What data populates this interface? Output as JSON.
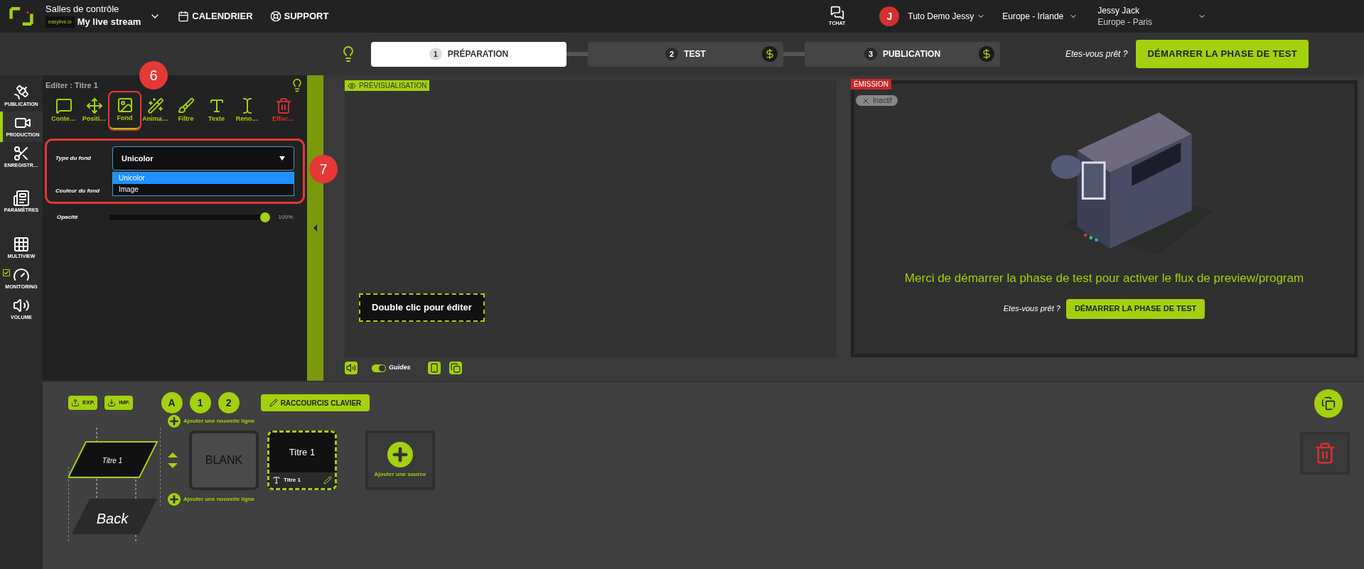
{
  "header": {
    "section": "Salles de contrôle",
    "brand": "easylive.io",
    "stream": "My live stream",
    "nav": [
      "CALENDRIER",
      "SUPPORT"
    ],
    "chat": "TCHAT",
    "avatar": "J",
    "account": "Tuto Demo Jessy",
    "region": "Europe - Irlande",
    "user": "Jessy Jack",
    "user_zone": "Europe - Paris"
  },
  "steps": [
    {
      "number": "1",
      "label": "PRÉPARATION",
      "selected": true,
      "paid": false
    },
    {
      "number": "2",
      "label": "TEST",
      "selected": false,
      "paid": true
    },
    {
      "number": "3",
      "label": "PUBLICATION",
      "selected": false,
      "paid": true
    }
  ],
  "ready_prompt": "Etes-vous prêt ?",
  "start_button": "DÉMARRER LA PHASE DE TEST",
  "sidebar": [
    {
      "label": "PUBLICATION",
      "kind": "plain",
      "selected": false
    },
    {
      "label": "PRODUCTION",
      "kind": "plain",
      "selected": true
    },
    {
      "label": "ENREGISTR…",
      "kind": "plain",
      "selected": false
    },
    {
      "label": "PARAMÈTRES",
      "kind": "plain",
      "selected": false
    },
    {
      "label": "MULTIVIEW",
      "kind": "plain",
      "selected": false
    },
    {
      "label": "MONITORING",
      "kind": "checkbox",
      "checked": true
    },
    {
      "label": "VOLUME",
      "kind": "plain",
      "selected": false
    }
  ],
  "editor": {
    "title": "Editer : Titre 1",
    "tools": [
      {
        "label": "Conte…",
        "selected": false,
        "danger": false
      },
      {
        "label": "Positi…",
        "selected": false,
        "danger": false
      },
      {
        "label": "Fond",
        "selected": true,
        "danger": false
      },
      {
        "label": "Anima…",
        "selected": false,
        "danger": false
      },
      {
        "label": "Filtre",
        "selected": false,
        "danger": false
      },
      {
        "label": "Texte",
        "selected": false,
        "danger": false
      },
      {
        "label": "Reno…",
        "selected": false,
        "danger": false
      },
      {
        "label": "Effac…",
        "selected": false,
        "danger": true
      }
    ],
    "type_label": "Type du fond",
    "type_value": "Unicolor",
    "options": [
      {
        "label": "Unicolor",
        "selected": true
      },
      {
        "label": "Image",
        "selected": false
      }
    ],
    "color_label": "Couleur du fond",
    "opacity_label": "Opacité",
    "opacity": {
      "level": 1
    },
    "opacity_reading": "100%"
  },
  "annotations": [
    "6",
    "7"
  ],
  "preview": {
    "label": "PRÉVISUALISATION",
    "overlay": "Double clic pour éditer",
    "guides_label": "Guides",
    "guides_on": true
  },
  "emission": {
    "label": "ÉMISSION",
    "status": "Inactif",
    "message": "Merci de démarrer la phase de test pour activer le flux de preview/program",
    "prompt": "Etes-vous prêt ?",
    "button": "DÉMARRER LA PHASE DE TEST"
  },
  "bottom": {
    "export": "EXP.",
    "import": "IMP.",
    "layers": [
      "A",
      "1",
      "2"
    ],
    "shortcuts": "RACCOURCIS CLAVIER",
    "add_line": [
      "Ajouter une nouvelle ligne",
      "Ajouter une nouvelle ligne"
    ],
    "stack": [
      "Titre 1",
      "Back"
    ],
    "sources": [
      {
        "kind": "blank",
        "label": "BLANK",
        "selected": false
      },
      {
        "kind": "title",
        "label": "Titre 1",
        "caption": "Titre 1",
        "selected": true
      }
    ],
    "add_source": "Ajouter une source"
  }
}
